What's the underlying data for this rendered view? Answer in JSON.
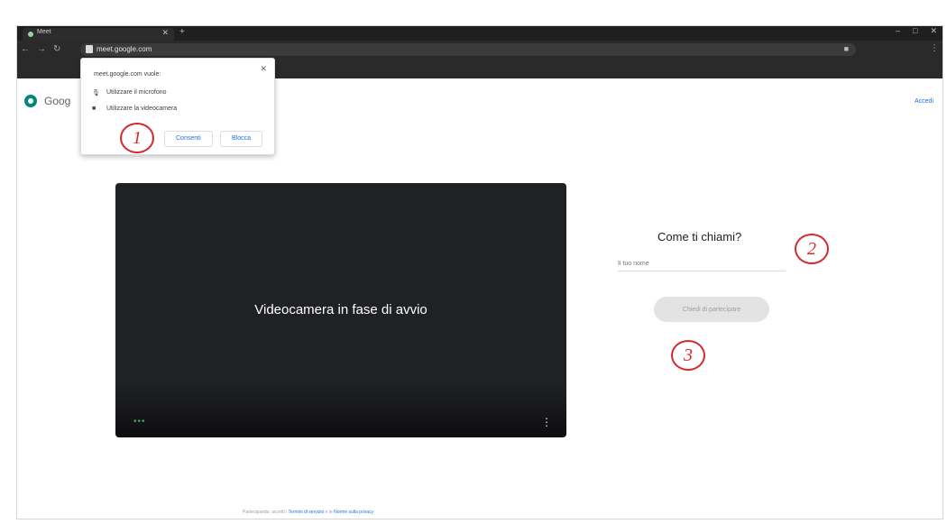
{
  "browser": {
    "tab_title": "Meet",
    "url": "meet.google.com"
  },
  "permission": {
    "title": "meet.google.com vuole:",
    "mic_label": "Utilizzare il microfono",
    "cam_label": "Utilizzare la videocamera",
    "allow_label": "Consenti",
    "block_label": "Blocca"
  },
  "header": {
    "logo_text": "Goog",
    "signin_label": "Accedi"
  },
  "video": {
    "status_text": "Videocamera in fase di avvio"
  },
  "join": {
    "question": "Come ti chiami?",
    "name_placeholder": "Il tuo nome",
    "join_label": "Chiedi di partecipare"
  },
  "annotations": [
    "1",
    "2",
    "3"
  ],
  "footer": {
    "prefix": "Partecipando, accetti i",
    "terms": "Termini di servizio",
    "and": "e le",
    "privacy": "Norme sulla privacy"
  },
  "colors": {
    "accent": "#1a73e8",
    "annotation": "#d42a2a",
    "video_bg": "#202124"
  }
}
